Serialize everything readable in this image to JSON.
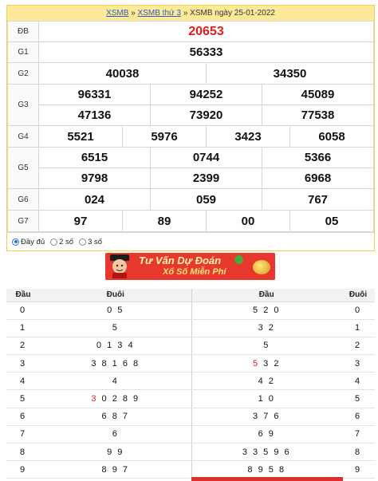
{
  "breadcrumb": {
    "link1": "XSMB",
    "sep1": "»",
    "link2": "XSMB thứ 3",
    "sep2": "»",
    "current": "XSMB ngày 25-01-2022"
  },
  "prizes": {
    "db": {
      "label": "ĐB",
      "values": [
        "20653"
      ]
    },
    "g1": {
      "label": "G1",
      "values": [
        "56333"
      ]
    },
    "g2": {
      "label": "G2",
      "values": [
        "40038",
        "34350"
      ]
    },
    "g3": {
      "label": "G3",
      "values": [
        "96331",
        "94252",
        "45089",
        "47136",
        "73920",
        "77538"
      ]
    },
    "g4": {
      "label": "G4",
      "values": [
        "5521",
        "5976",
        "3423",
        "6058"
      ]
    },
    "g5": {
      "label": "G5",
      "values": [
        "6515",
        "0744",
        "5366",
        "9798",
        "2399",
        "6968"
      ]
    },
    "g6": {
      "label": "G6",
      "values": [
        "024",
        "059",
        "767"
      ]
    },
    "g7": {
      "label": "G7",
      "values": [
        "97",
        "89",
        "00",
        "05"
      ]
    }
  },
  "options": [
    {
      "label": "Đầy đủ",
      "selected": true
    },
    {
      "label": "2 số",
      "selected": false
    },
    {
      "label": "3 số",
      "selected": false
    }
  ],
  "banner": {
    "line1": "Tư Vấn Dự Đoán",
    "line2": "Xổ Số Miễn Phí"
  },
  "loto": {
    "headers": [
      "Đầu",
      "Đuôi",
      "Đầu",
      "Đuôi"
    ],
    "rows": [
      {
        "dau": "0",
        "duoi": "0 5",
        "dau2": "5 2 0",
        "duoi2": "0"
      },
      {
        "dau": "1",
        "duoi": "5",
        "dau2": "3 2",
        "duoi2": "1"
      },
      {
        "dau": "2",
        "duoi": "0 1 3 4",
        "dau2": "5",
        "duoi2": "2"
      },
      {
        "dau": "3",
        "duoi": "3 8 1 6 8",
        "dau2_red": "5",
        "dau2": " 3 2",
        "duoi2": "3"
      },
      {
        "dau": "4",
        "duoi": "4",
        "dau2": "4 2",
        "duoi2": "4"
      },
      {
        "dau": "5",
        "duoi_red": "3",
        "duoi": "0 2 8 9",
        "dau2": "1 0",
        "duoi2": "5"
      },
      {
        "dau": "6",
        "duoi": "6 8 7",
        "dau2": "3 7 6",
        "duoi2": "6"
      },
      {
        "dau": "7",
        "duoi": "6",
        "dau2": "6 9",
        "duoi2": "7"
      },
      {
        "dau": "8",
        "duoi": "9 9",
        "dau2": "3 3 5 9 6",
        "duoi2": "8"
      },
      {
        "dau": "9",
        "duoi": "8 9 7",
        "dau2": "8 9 5 8",
        "duoi2": "9"
      }
    ]
  },
  "colors": {
    "accent_red": "#e41c1c",
    "header_bg": "#fde99a",
    "link": "#2a5db0",
    "banner_red": "#e8382d"
  }
}
